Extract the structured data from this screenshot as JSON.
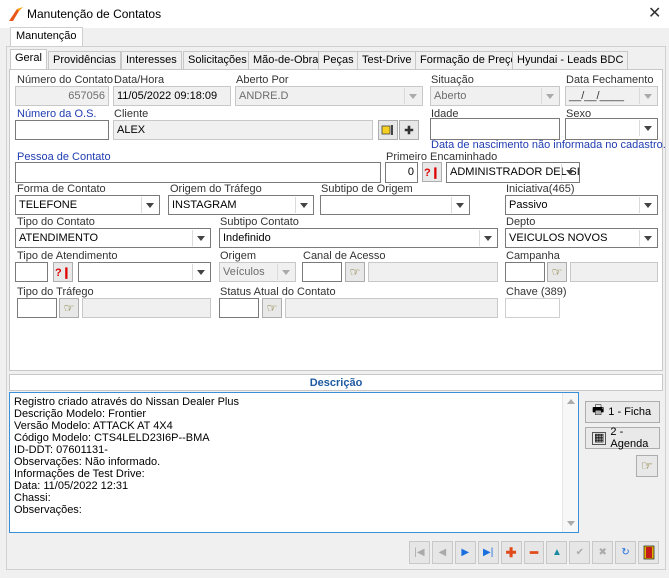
{
  "window": {
    "title": "Manutenção de Contatos",
    "close_glyph": "✕"
  },
  "menu_tab": "Manutenção",
  "tabs": [
    "Geral",
    "Providências",
    "Interesses",
    "Solicitações",
    "Mão-de-Obra",
    "Peças",
    "Test-Drive",
    "Formação de Preço",
    "Hyundai - Leads BDC"
  ],
  "fields": {
    "numero_contato": {
      "label": "Número do Contato",
      "value": "657056"
    },
    "data_hora": {
      "label": "Data/Hora",
      "value": "11/05/2022 09:18:09"
    },
    "aberto_por": {
      "label": "Aberto Por",
      "value": "ANDRE.D"
    },
    "situacao": {
      "label": "Situação",
      "value": "Aberto"
    },
    "data_fechamento": {
      "label": "Data Fechamento",
      "value": "__/__/____"
    },
    "numero_os": {
      "label": "Número da O.S.",
      "value": ""
    },
    "cliente": {
      "label": "Cliente",
      "value": "ALEX "
    },
    "idade": {
      "label": "Idade",
      "value": ""
    },
    "sexo": {
      "label": "Sexo",
      "value": ""
    },
    "aviso_nascimento": "Data de nascimento não informada no cadastro.",
    "pessoa_contato": {
      "label": "Pessoa de Contato",
      "value": ""
    },
    "primeiro_encaminhado": {
      "label": "Primeiro Encaminhado",
      "number": "0",
      "value": "ADMINISTRADOR DEL SI"
    },
    "forma_contato": {
      "label": "Forma de Contato",
      "value": "TELEFONE"
    },
    "origem_trafego": {
      "label": "Origem do Tráfego",
      "value": "INSTAGRAM"
    },
    "subtipo_origem": {
      "label": "Subtipo de Origem",
      "value": ""
    },
    "iniciativa": {
      "label": "Iniciativa(465)",
      "value": "Passivo"
    },
    "tipo_contato": {
      "label": "Tipo do Contato",
      "value": "ATENDIMENTO"
    },
    "subtipo_contato": {
      "label": "Subtipo Contato",
      "value": "Indefinido"
    },
    "depto": {
      "label": "Depto",
      "value": "VEICULOS NOVOS"
    },
    "tipo_atendimento": {
      "label": "Tipo de Atendimento",
      "value": ""
    },
    "origem": {
      "label": "Origem",
      "value": "Veículos"
    },
    "canal_acesso": {
      "label": "Canal de Acesso",
      "value": ""
    },
    "campanha": {
      "label": "Campanha",
      "value": ""
    },
    "tipo_trafego": {
      "label": "Tipo do Tráfego",
      "value": ""
    },
    "status_atual": {
      "label": "Status Atual do Contato",
      "value": ""
    },
    "chave": {
      "label": "Chave (389)",
      "value": ""
    }
  },
  "descricao": {
    "label": "Descrição",
    "text": "Registro criado através do Nissan Dealer Plus\nDescrição Modelo: Frontier\nVersão Modelo: ATTACK AT 4X4\nCódigo Modelo: CTS4LELD23I6P--BMA\nID-DDT: 07601131-\nObservações: Não informado.\nInformações de Test Drive:\nData: 11/05/2022 12:31\nChassi: \nObservações:"
  },
  "side_buttons": {
    "ficha": "1 - Ficha",
    "agenda": "2 - Agenda"
  },
  "colors": {
    "accent_blue": "#1f3cb0",
    "description_header": "#1e5aa0"
  }
}
